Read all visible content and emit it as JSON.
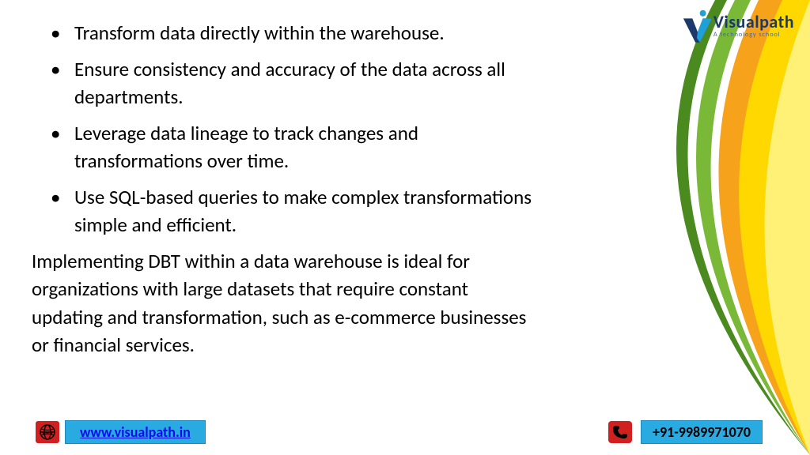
{
  "logo": {
    "main": "Visualpath",
    "sub": "A technology school"
  },
  "bullets": [
    "Transform data directly within the warehouse.",
    "Ensure consistency and accuracy of the data across all departments.",
    "Leverage data lineage to track changes and transformations over time.",
    "Use SQL-based queries to make complex transformations simple and efficient."
  ],
  "paragraph": "Implementing DBT within a data warehouse is ideal for organizations with large datasets that require constant updating and transformation, such as e-commerce businesses or financial services.",
  "footer": {
    "website": "www.visualpath.in",
    "phone": "+91-9989971070"
  }
}
